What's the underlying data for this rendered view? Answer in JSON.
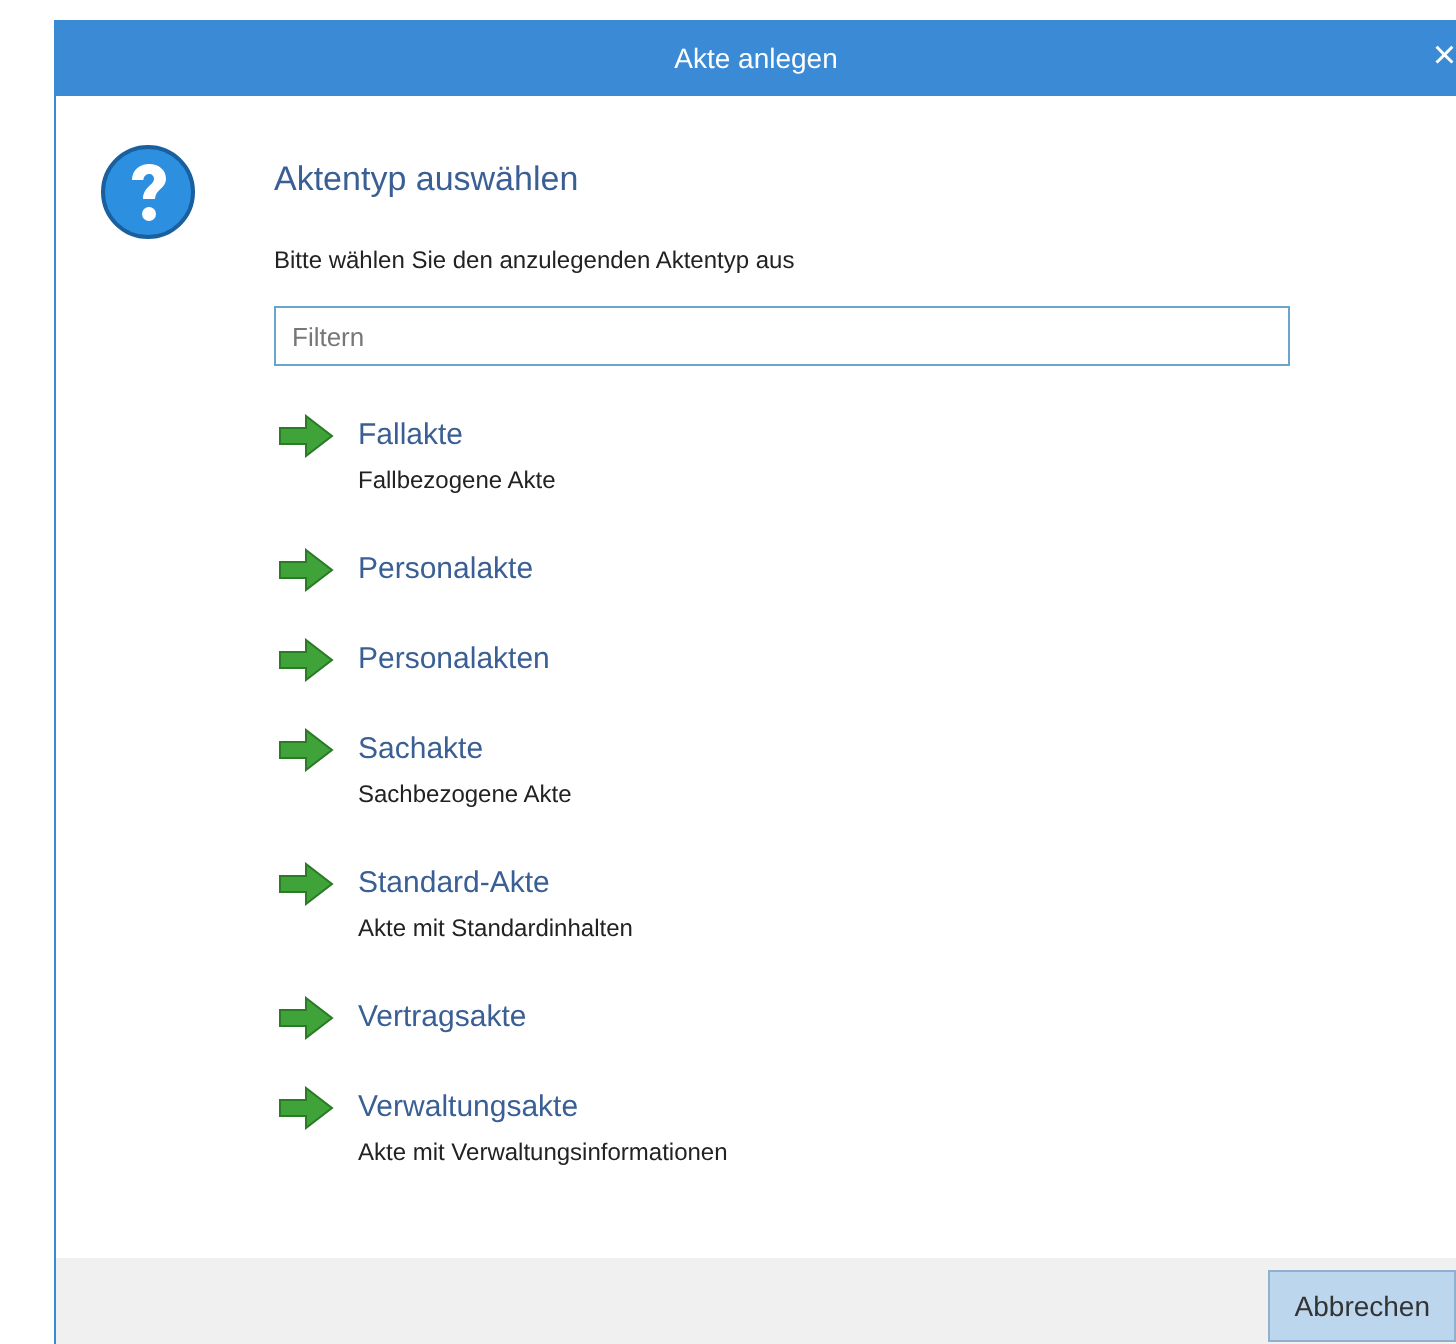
{
  "window": {
    "title": "Akte anlegen",
    "close": "×"
  },
  "heading": "Aktentyp auswählen",
  "instruction": "Bitte wählen Sie den anzulegenden Aktentyp aus",
  "filter": {
    "placeholder": "Filtern"
  },
  "items": [
    {
      "title": "Fallakte",
      "description": "Fallbezogene Akte"
    },
    {
      "title": "Personalakte"
    },
    {
      "title": "Personalakten"
    },
    {
      "title": "Sachakte",
      "description": "Sachbezogene Akte"
    },
    {
      "title": "Standard-Akte",
      "description": "Akte mit Standardinhalten"
    },
    {
      "title": "Vertragsakte"
    },
    {
      "title": "Verwaltungsakte",
      "description": "Akte mit Verwaltungsinformationen"
    }
  ],
  "buttons": [
    "Abbrechen"
  ]
}
